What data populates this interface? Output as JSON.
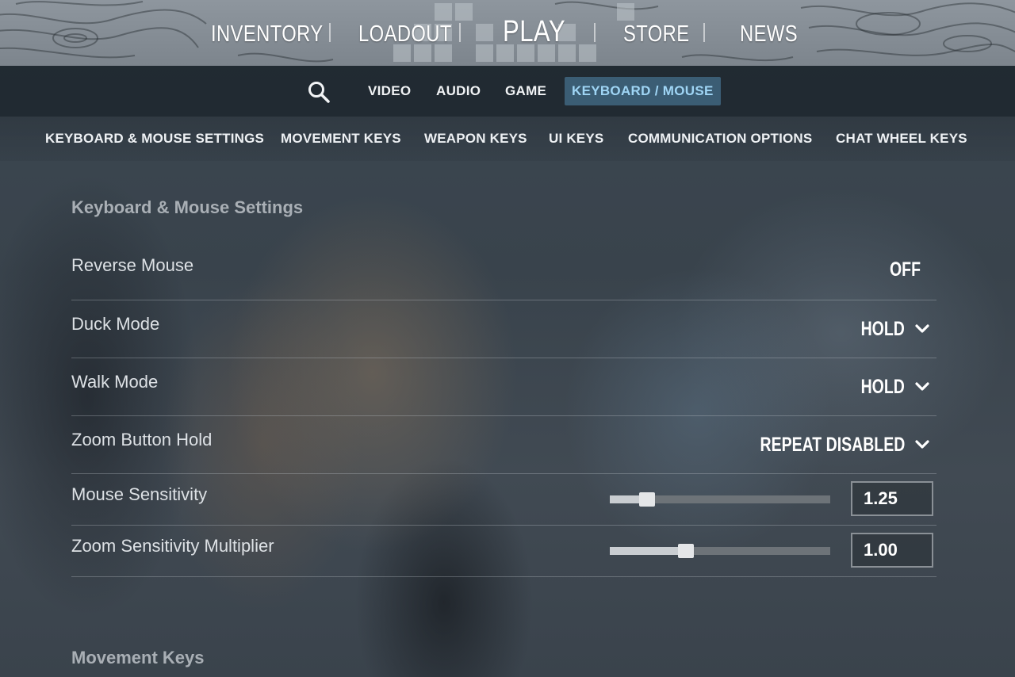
{
  "top_nav": {
    "items": [
      "INVENTORY",
      "LOADOUT",
      "PLAY",
      "STORE",
      "NEWS"
    ]
  },
  "settings_tabs": {
    "search_icon": "search-icon",
    "items": [
      "VIDEO",
      "AUDIO",
      "GAME",
      "KEYBOARD / MOUSE"
    ],
    "active": "KEYBOARD / MOUSE",
    "active_color": "#9fd5f5",
    "active_bg": "#3b5d74"
  },
  "section_tabs": [
    "KEYBOARD & MOUSE SETTINGS",
    "MOVEMENT KEYS",
    "WEAPON KEYS",
    "UI KEYS",
    "COMMUNICATION OPTIONS",
    "CHAT WHEEL KEYS"
  ],
  "keyboard_mouse_settings": {
    "title": "Keyboard & Mouse Settings",
    "rows": [
      {
        "label": "Reverse Mouse",
        "value": "OFF"
      },
      {
        "label": "Duck Mode",
        "value": "HOLD"
      },
      {
        "label": "Walk Mode",
        "value": "HOLD"
      },
      {
        "label": "Zoom Button Hold",
        "value": "REPEAT DISABLED"
      }
    ],
    "sliders": [
      {
        "label": "Mouse Sensitivity",
        "value": "1.25",
        "fraction": 0.17
      },
      {
        "label": "Zoom Sensitivity Multiplier",
        "value": "1.00",
        "fraction": 0.345
      }
    ]
  },
  "movement_keys": {
    "title": "Movement Keys"
  }
}
